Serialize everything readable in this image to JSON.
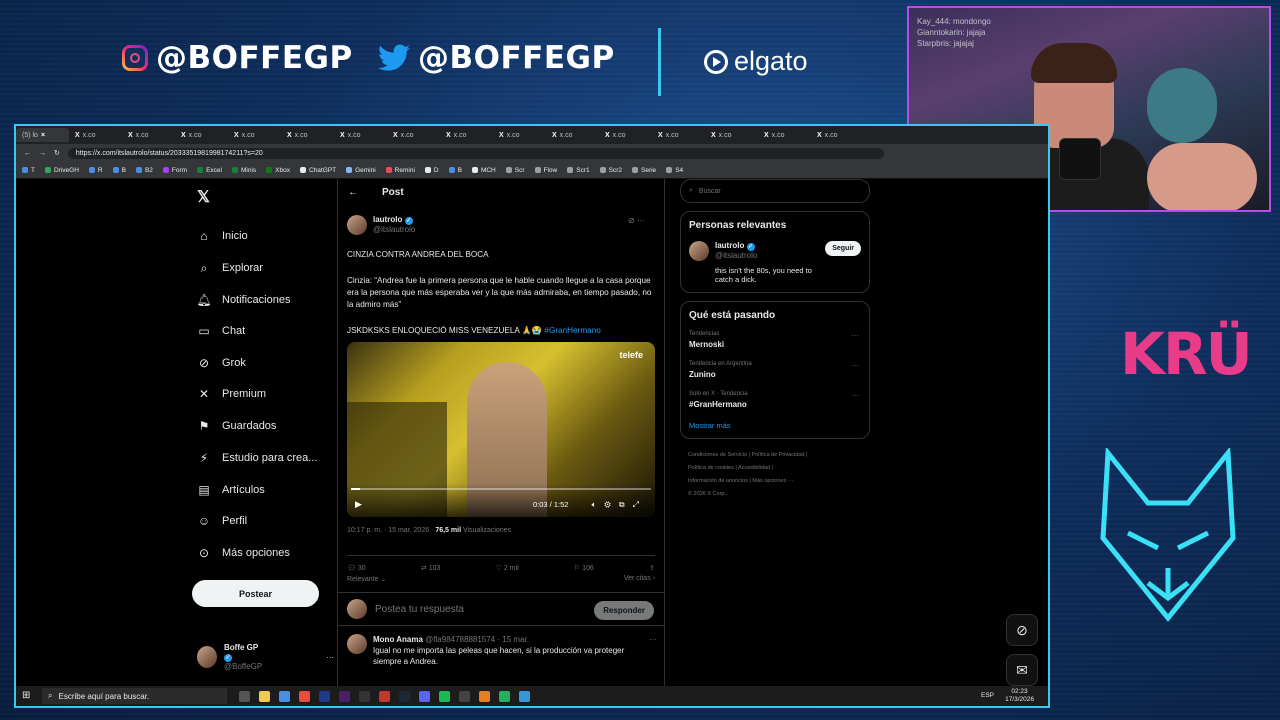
{
  "overlay": {
    "instagram": "@BOFFEGP",
    "twitter": "@BOFFEGP",
    "sponsor": "elgato",
    "team": "KRÜ",
    "cam_chat": [
      "Kay_444: mondongo",
      "Gianntokarin: jajaja",
      "Starpbris: jajajaj"
    ]
  },
  "browser": {
    "tabs": [
      "(5) lo",
      "x.co",
      "x.co",
      "x.co",
      "x.co",
      "x.co",
      "x.co",
      "x.co",
      "x.co",
      "x.co",
      "x.co",
      "x.co",
      "x.co",
      "x.co",
      "x.co",
      "x.co"
    ],
    "url": "https://x.com/itslautrolo/status/2033351981998174211?s=20",
    "bookmarks": [
      "T",
      "DriveGH",
      "R",
      "B",
      "B2",
      "Form",
      "Excel",
      "Minis",
      "Xbox",
      "ChatGPT",
      "Gemini",
      "Remini",
      "D",
      "B",
      "MCH",
      "Scr",
      "Flow",
      "Scr1",
      "Scr2",
      "Serie",
      "S4"
    ]
  },
  "nav": {
    "items": [
      "Inicio",
      "Explorar",
      "Notificaciones",
      "Chat",
      "Grok",
      "Premium",
      "Guardados",
      "Estudio para crea...",
      "Artículos",
      "Perfil",
      "Más opciones"
    ],
    "post_button": "Postear",
    "me_name": "Boffe GP",
    "me_handle": "@BoffeGP"
  },
  "post": {
    "header": "Post",
    "author": "lautrolo",
    "handle": "@itslautrolo",
    "line1": "CINZIA CONTRA ANDREA DEL BOCA",
    "line2": "Cinzia: “Andrea fue la primera persona que le hable cuando llegue a la casa porque era la persona que más esperaba ver y la que más admiraba, en tiempo pasado, no la admiro más”",
    "line3": "JSKDKSKS ENLOQUECIÓ MISS VENEZUELA 🙏😭",
    "hashtag": "#GranHermano",
    "video_time": "0:03 / 1:52",
    "video_badge": "telefe",
    "date": "10:17 p. m. · 15 mar. 2026 · ",
    "views": "76,5 mil",
    "views_label": " Visualizaciones",
    "replies": "30",
    "reposts": "103",
    "likes": "2 mil",
    "bookmarks": "106",
    "relevant": "Relevante",
    "quotes": "Ver citas",
    "reply_placeholder": "Postea tu respuesta",
    "reply_button": "Responder"
  },
  "comment": {
    "author": "Mono Anama",
    "meta": "@fla984788881574 · 15 mar.",
    "text": "Igual no me importa las peleas que hacen, si la producción va proteger siempre a Andrea."
  },
  "sidebar": {
    "search_placeholder": "Buscar",
    "people_title": "Personas relevantes",
    "person_name": "lautrolo",
    "person_handle": "@itslautrolo",
    "follow": "Seguir",
    "person_bio": "this isn't the 80s, you need to catch a dick.",
    "trends_title": "Qué está pasando",
    "trends": [
      {
        "context": "Tendencias",
        "name": "Mernoski"
      },
      {
        "context": "Tendencia en Argentina",
        "name": "Zunino"
      },
      {
        "context": "Solo en X · Tendencia",
        "name": "#GranHermano"
      }
    ],
    "show_more": "Mostrar más",
    "footer1": "Condiciones de Servicio  |  Política de Privacidad  |",
    "footer2": "Política de cookies  |  Accesibilidad  |",
    "footer3": "Información de anuncios  |  Más opciones ···",
    "footer4": "© 2026 X Corp."
  },
  "taskbar": {
    "search": "Escribe aquí para buscar.",
    "lang": "ESP",
    "time": "02:23",
    "date": "17/3/2026"
  },
  "colors": {
    "accent": "#1d9bf0",
    "frame": "#3ac8f0",
    "kru": "#e83b8a"
  }
}
